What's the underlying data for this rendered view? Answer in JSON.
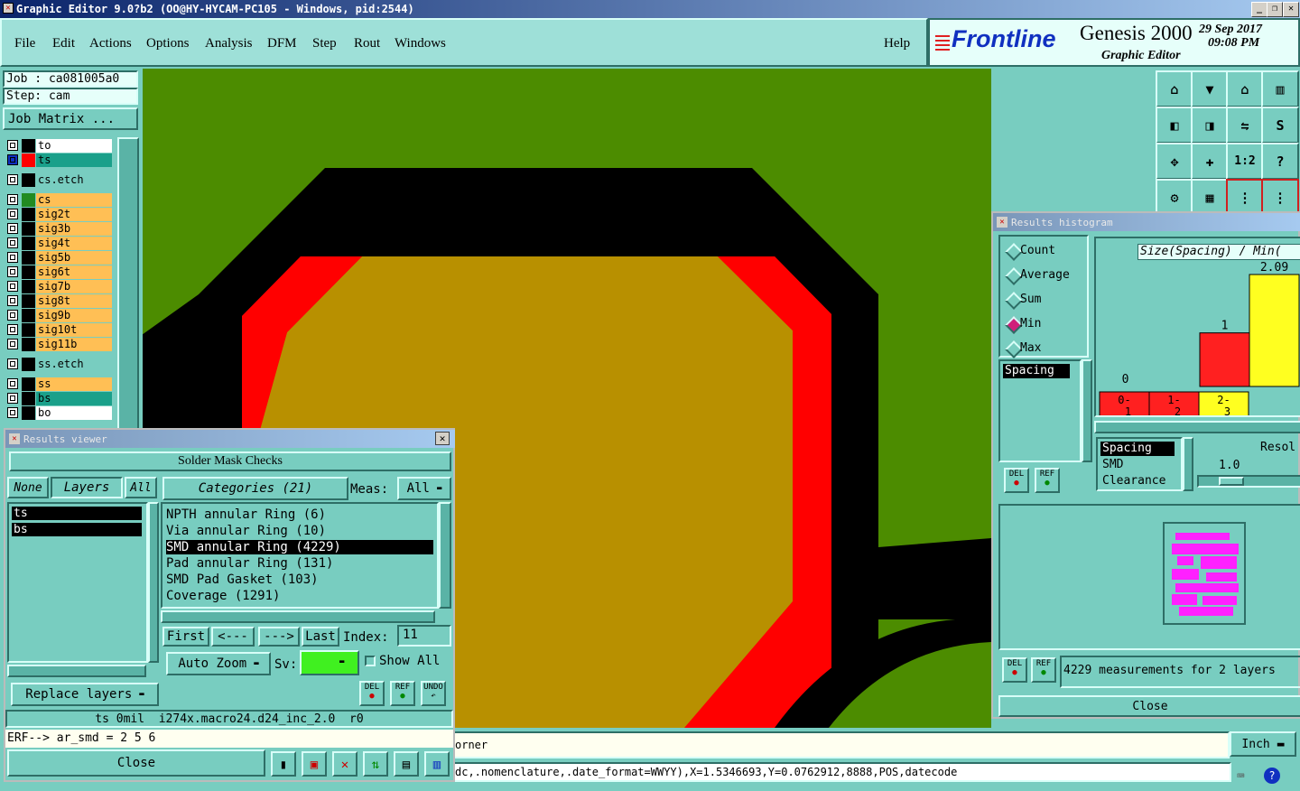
{
  "window": {
    "title": "Graphic Editor 9.0?b2 (OO@HY-HYCAM-PC105 - Windows, pid:2544)"
  },
  "menu": [
    "File",
    "Edit",
    "Actions",
    "Options",
    "Analysis",
    "DFM",
    "Step",
    "Rout",
    "Windows"
  ],
  "menu_help": "Help",
  "brand": {
    "logo": "Frontline",
    "product": "Genesis 2000",
    "subtitle": "Graphic Editor",
    "date": "29 Sep 2017",
    "time": "09:08 PM"
  },
  "job": {
    "job_label": "Job : ca081005a0",
    "step_label": "Step: cam",
    "matrix_button": "Job Matrix ..."
  },
  "layers": [
    {
      "name": "to",
      "swatch": "#000000",
      "color": "#ffffff",
      "sel": false
    },
    {
      "name": "ts",
      "swatch": "#ff0000",
      "color": "#1aa08a",
      "sel": true
    },
    {
      "name": "cs.etch",
      "swatch": "#000000",
      "color": "#78cdc0",
      "sel": false
    },
    {
      "name": "cs",
      "swatch": "#228b22",
      "color": "#ffbf55",
      "sel": false
    },
    {
      "name": "sig2t",
      "swatch": "#000000",
      "color": "#ffbf55",
      "sel": false
    },
    {
      "name": "sig3b",
      "swatch": "#000000",
      "color": "#ffbf55",
      "sel": false
    },
    {
      "name": "sig4t",
      "swatch": "#000000",
      "color": "#ffbf55",
      "sel": false
    },
    {
      "name": "sig5b",
      "swatch": "#000000",
      "color": "#ffbf55",
      "sel": false
    },
    {
      "name": "sig6t",
      "swatch": "#000000",
      "color": "#ffbf55",
      "sel": false
    },
    {
      "name": "sig7b",
      "swatch": "#000000",
      "color": "#ffbf55",
      "sel": false
    },
    {
      "name": "sig8t",
      "swatch": "#000000",
      "color": "#ffbf55",
      "sel": false
    },
    {
      "name": "sig9b",
      "swatch": "#000000",
      "color": "#ffbf55",
      "sel": false
    },
    {
      "name": "sig10t",
      "swatch": "#000000",
      "color": "#ffbf55",
      "sel": false
    },
    {
      "name": "sig11b",
      "swatch": "#000000",
      "color": "#ffbf55",
      "sel": false
    },
    {
      "name": "ss.etch",
      "swatch": "#000000",
      "color": "#78cdc0",
      "sel": false
    },
    {
      "name": "ss",
      "swatch": "#000000",
      "color": "#ffbf55",
      "sel": false
    },
    {
      "name": "bs",
      "swatch": "#000000",
      "color": "#1aa08a",
      "sel": false
    },
    {
      "name": "bo",
      "swatch": "#000000",
      "color": "#ffffff",
      "sel": false
    }
  ],
  "results_viewer": {
    "title": "Results viewer",
    "header": "Solder Mask Checks",
    "none_btn": "None",
    "layers_btn": "Layers",
    "all_btn": "All",
    "layer_items": [
      "ts",
      "bs"
    ],
    "categories_btn": "Categories (21)",
    "meas_label": "Meas:",
    "meas_value": "All",
    "categories": [
      "NPTH annular Ring (6)",
      "Via annular Ring (10)",
      "SMD annular Ring (4229)",
      "Pad annular Ring (131)",
      "SMD Pad Gasket (103)",
      "Coverage (1291)"
    ],
    "selected_category": 2,
    "first_btn": "First",
    "prev_btn": "<---",
    "next_btn": "--->",
    "last_btn": "Last",
    "index_label": "Index:",
    "index_value": "11",
    "auto_zoom": "Auto Zoom",
    "sv_label": "Sv:",
    "show_all": "Show All",
    "replace_layers": "Replace layers",
    "del": "DEL",
    "ref": "REF",
    "undo": "UNDO",
    "status": "ts 0mil  i274x.macro24.d24_inc_2.0  r0",
    "erf": "ERF--> ar_smd = 2 5 6",
    "close": "Close"
  },
  "histogram": {
    "title": "Results histogram",
    "modes": [
      "Count",
      "Average",
      "Sum",
      "Min",
      "Max"
    ],
    "selected_mode": 3,
    "metric_list": [
      "Spacing"
    ],
    "chart_title": "Size(Spacing) / Min(",
    "metrics2": [
      "Spacing",
      "SMD",
      "Clearance"
    ],
    "resol_label": "Resol",
    "resol_value": "1.0",
    "summary": "4229 measurements for 2 layers",
    "close": "Close",
    "del": "DEL",
    "ref": "REF"
  },
  "chart_data": {
    "type": "bar",
    "categories": [
      "0-1",
      "1-2",
      "2-3"
    ],
    "values": [
      0,
      1,
      2.09
    ],
    "data_labels": [
      "0",
      "1",
      "2.09"
    ],
    "colors": [
      "#ff2020",
      "#ff2020",
      "#ffff20"
    ],
    "title": "Size(Spacing) / Min(",
    "ylim": [
      0,
      2.09
    ]
  },
  "bottom": {
    "line": "orner",
    "unit": "Inch",
    "cmd": "dc,.nomenclature,.date_format=WWYY),X=1.5346693,Y=0.0762912,8888,POS,datecode"
  },
  "toolbar_labels": [
    "1:2",
    "?"
  ]
}
